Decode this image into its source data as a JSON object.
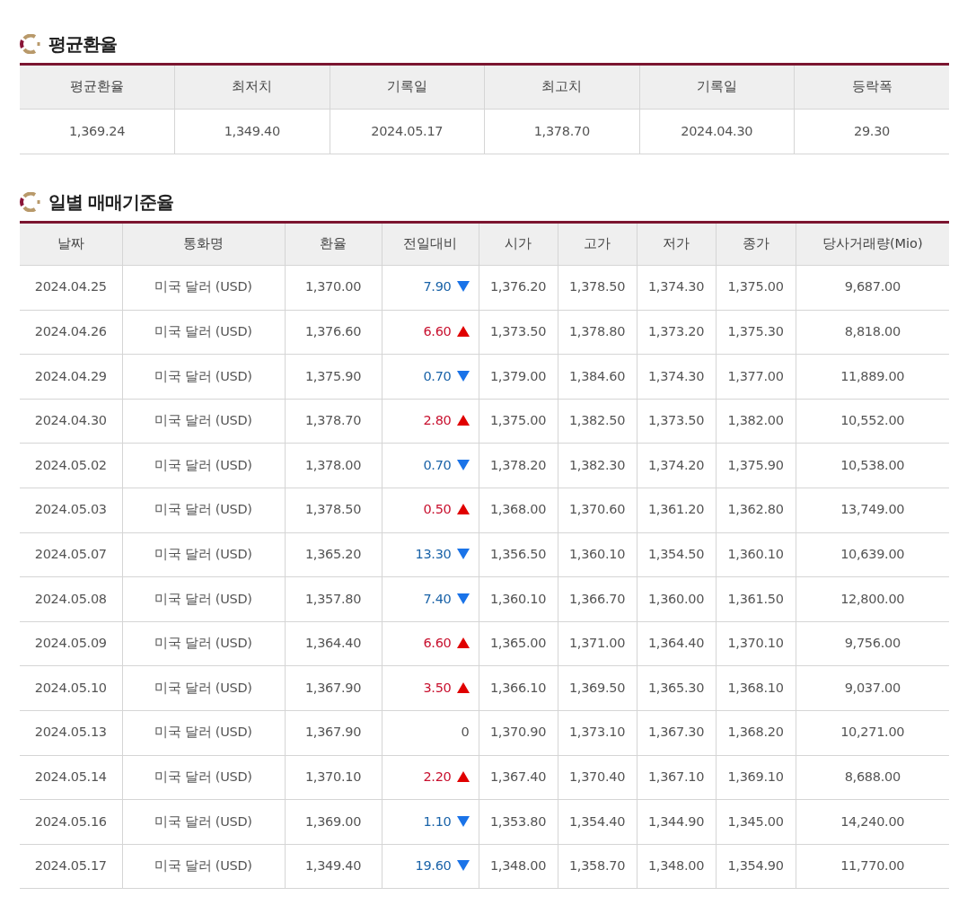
{
  "average_section": {
    "title": "평균환율",
    "columns": [
      "평균환율",
      "최저치",
      "기록일",
      "최고치",
      "기록일",
      "등락폭"
    ],
    "row": [
      "1,369.24",
      "1,349.40",
      "2024.05.17",
      "1,378.70",
      "2024.04.30",
      "29.30"
    ]
  },
  "daily_section": {
    "title": "일별 매매기준율",
    "columns": [
      "날짜",
      "통화명",
      "환율",
      "전일대비",
      "시가",
      "고가",
      "저가",
      "종가",
      "당사거래량(Mio)"
    ],
    "rows": [
      {
        "date": "2024.04.25",
        "currency": "미국 달러 (USD)",
        "rate": "1,370.00",
        "change": "7.90",
        "kind": "down",
        "open": "1,376.20",
        "high": "1,378.50",
        "low": "1,374.30",
        "close": "1,375.00",
        "volume": "9,687.00"
      },
      {
        "date": "2024.04.26",
        "currency": "미국 달러 (USD)",
        "rate": "1,376.60",
        "change": "6.60",
        "kind": "up",
        "open": "1,373.50",
        "high": "1,378.80",
        "low": "1,373.20",
        "close": "1,375.30",
        "volume": "8,818.00"
      },
      {
        "date": "2024.04.29",
        "currency": "미국 달러 (USD)",
        "rate": "1,375.90",
        "change": "0.70",
        "kind": "down",
        "open": "1,379.00",
        "high": "1,384.60",
        "low": "1,374.30",
        "close": "1,377.00",
        "volume": "11,889.00"
      },
      {
        "date": "2024.04.30",
        "currency": "미국 달러 (USD)",
        "rate": "1,378.70",
        "change": "2.80",
        "kind": "up",
        "open": "1,375.00",
        "high": "1,382.50",
        "low": "1,373.50",
        "close": "1,382.00",
        "volume": "10,552.00"
      },
      {
        "date": "2024.05.02",
        "currency": "미국 달러 (USD)",
        "rate": "1,378.00",
        "change": "0.70",
        "kind": "down",
        "open": "1,378.20",
        "high": "1,382.30",
        "low": "1,374.20",
        "close": "1,375.90",
        "volume": "10,538.00"
      },
      {
        "date": "2024.05.03",
        "currency": "미국 달러 (USD)",
        "rate": "1,378.50",
        "change": "0.50",
        "kind": "up",
        "open": "1,368.00",
        "high": "1,370.60",
        "low": "1,361.20",
        "close": "1,362.80",
        "volume": "13,749.00"
      },
      {
        "date": "2024.05.07",
        "currency": "미국 달러 (USD)",
        "rate": "1,365.20",
        "change": "13.30",
        "kind": "down",
        "open": "1,356.50",
        "high": "1,360.10",
        "low": "1,354.50",
        "close": "1,360.10",
        "volume": "10,639.00"
      },
      {
        "date": "2024.05.08",
        "currency": "미국 달러 (USD)",
        "rate": "1,357.80",
        "change": "7.40",
        "kind": "down",
        "open": "1,360.10",
        "high": "1,366.70",
        "low": "1,360.00",
        "close": "1,361.50",
        "volume": "12,800.00"
      },
      {
        "date": "2024.05.09",
        "currency": "미국 달러 (USD)",
        "rate": "1,364.40",
        "change": "6.60",
        "kind": "up",
        "open": "1,365.00",
        "high": "1,371.00",
        "low": "1,364.40",
        "close": "1,370.10",
        "volume": "9,756.00"
      },
      {
        "date": "2024.05.10",
        "currency": "미국 달러 (USD)",
        "rate": "1,367.90",
        "change": "3.50",
        "kind": "up",
        "open": "1,366.10",
        "high": "1,369.50",
        "low": "1,365.30",
        "close": "1,368.10",
        "volume": "9,037.00"
      },
      {
        "date": "2024.05.13",
        "currency": "미국 달러 (USD)",
        "rate": "1,367.90",
        "change": "0",
        "kind": "flat",
        "open": "1,370.90",
        "high": "1,373.10",
        "low": "1,367.30",
        "close": "1,368.20",
        "volume": "10,271.00"
      },
      {
        "date": "2024.05.14",
        "currency": "미국 달러 (USD)",
        "rate": "1,370.10",
        "change": "2.20",
        "kind": "up",
        "open": "1,367.40",
        "high": "1,370.40",
        "low": "1,367.10",
        "close": "1,369.10",
        "volume": "8,688.00"
      },
      {
        "date": "2024.05.16",
        "currency": "미국 달러 (USD)",
        "rate": "1,369.00",
        "change": "1.10",
        "kind": "down",
        "open": "1,353.80",
        "high": "1,354.40",
        "low": "1,344.90",
        "close": "1,345.00",
        "volume": "14,240.00"
      },
      {
        "date": "2024.05.17",
        "currency": "미국 달러 (USD)",
        "rate": "1,349.40",
        "change": "19.60",
        "kind": "down",
        "open": "1,348.00",
        "high": "1,358.70",
        "low": "1,348.00",
        "close": "1,354.90",
        "volume": "11,770.00"
      }
    ]
  }
}
